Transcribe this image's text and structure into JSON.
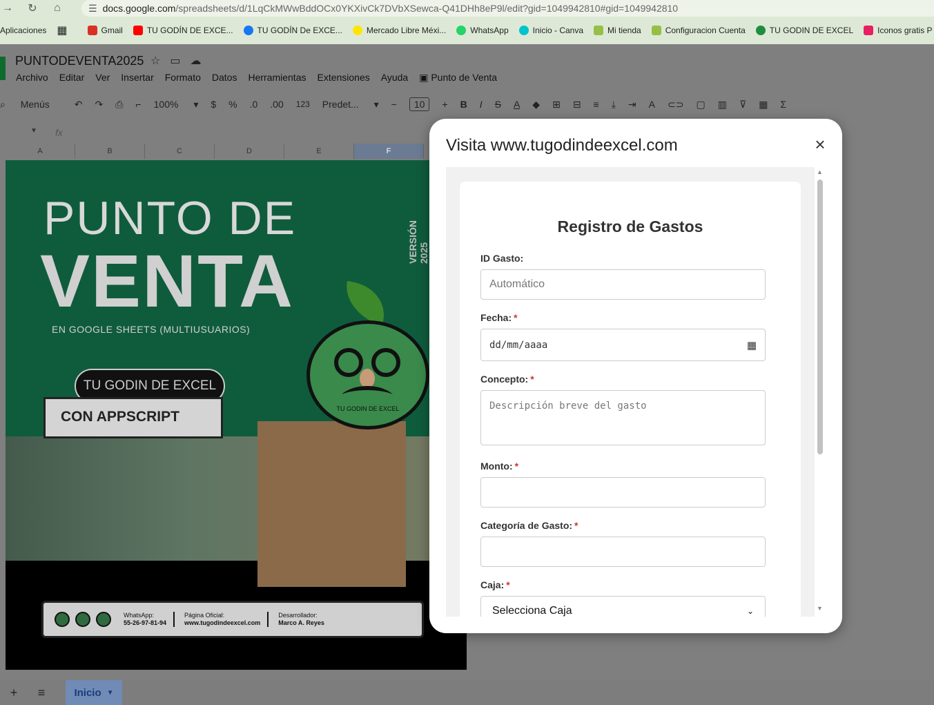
{
  "browser": {
    "url_host": "docs.google.com",
    "url_path": "/spreadsheets/d/1LqCkMWwBddOCx0YKXivCk7DVbXSewca-Q41DHh8eP9l/edit?gid=1049942810#gid=1049942810",
    "bookmarks": [
      {
        "label": "Aplicaciones",
        "color": ""
      },
      {
        "label": "Gmail",
        "color": "#d93025"
      },
      {
        "label": "TU GODÍN DE EXCE...",
        "color": "#ff0000"
      },
      {
        "label": "TU GODÍN De EXCE...",
        "color": "#1877f2"
      },
      {
        "label": "Mercado Libre Méxi...",
        "color": "#ffe600"
      },
      {
        "label": "WhatsApp",
        "color": "#25d366"
      },
      {
        "label": "Inicio - Canva",
        "color": "#00c4cc"
      },
      {
        "label": "Mi tienda",
        "color": "#95bf47"
      },
      {
        "label": "Configuracion Cuenta",
        "color": "#95bf47"
      },
      {
        "label": "TU GODIN DE EXCEL",
        "color": "#1e8e3e"
      },
      {
        "label": "Iconos gratis P",
        "color": "#e91e63"
      }
    ]
  },
  "sheets": {
    "doc_title": "PUNTODEVENTA2025",
    "menus": [
      "Archivo",
      "Editar",
      "Ver",
      "Insertar",
      "Formato",
      "Datos",
      "Herramientas",
      "Extensiones",
      "Ayuda",
      "Punto de Venta"
    ],
    "toolbar": {
      "menus_label": "Menús",
      "zoom": "100%",
      "currency": "$",
      "percent": "%",
      "dec_less": ".0",
      "dec_more": ".00",
      "number_format": "123",
      "font": "Predet...",
      "font_size": "10"
    },
    "fx": "fx",
    "columns": [
      "A",
      "B",
      "C",
      "D",
      "E",
      "F"
    ],
    "selected_column": "F",
    "tab_name": "Inicio"
  },
  "banner": {
    "title_line1": "PUNTO DE",
    "title_line2": "VENTA",
    "subtitle": "EN GOOGLE SHEETS (MULTIUSUARIOS)",
    "version": "VERSIÓN 2025",
    "pill": "TU GODIN DE EXCEL",
    "box": "CON APPSCRIPT",
    "logo_text": "TU GODIN DE EXCEL",
    "footer": [
      {
        "label": "WhatsApp:",
        "value": "55-26-97-81-94"
      },
      {
        "label": "Página Oficial:",
        "value": "www.tugodindeexcel.com"
      },
      {
        "label": "Desarrollador:",
        "value": "Marco A. Reyes"
      }
    ]
  },
  "modal": {
    "title": "Visita www.tugodindeexcel.com",
    "close": "×",
    "form": {
      "heading": "Registro de Gastos",
      "fields": {
        "id": {
          "label": "ID Gasto:",
          "placeholder": "Automático"
        },
        "fecha": {
          "label": "Fecha:",
          "value": "dd/mm/aaaa"
        },
        "concepto": {
          "label": "Concepto:",
          "placeholder": "Descripción breve del gasto"
        },
        "monto": {
          "label": "Monto:"
        },
        "categoria": {
          "label": "Categoría de Gasto:"
        },
        "caja": {
          "label": "Caja:",
          "selected": "Selecciona Caja"
        }
      },
      "required_mark": "*"
    }
  }
}
